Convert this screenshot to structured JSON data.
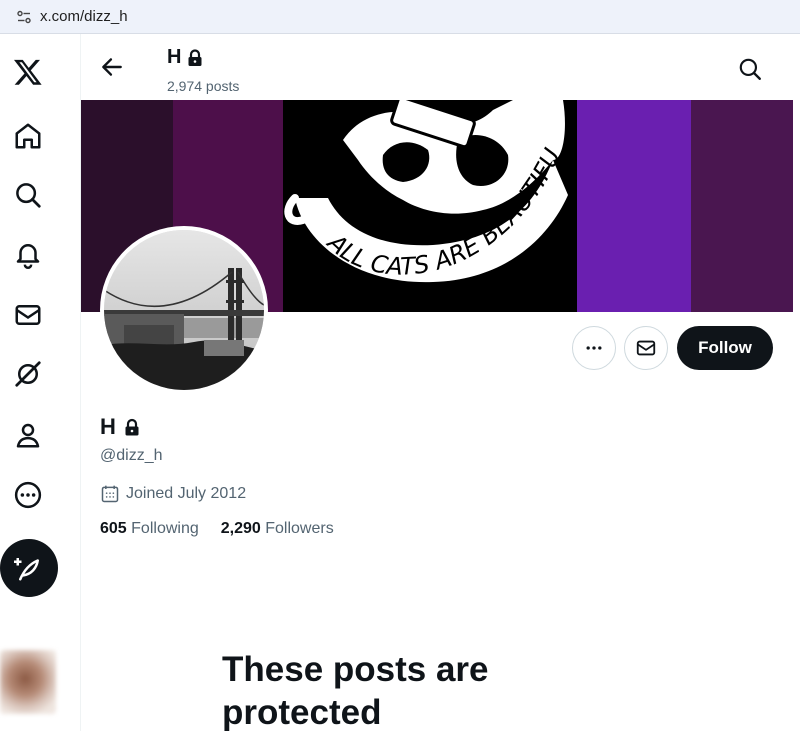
{
  "browser": {
    "url": "x.com/dizz_h"
  },
  "nav": {
    "items": [
      {
        "name": "x-logo-icon"
      },
      {
        "name": "home-icon"
      },
      {
        "name": "explore-icon"
      },
      {
        "name": "notifications-icon"
      },
      {
        "name": "messages-icon"
      },
      {
        "name": "grok-icon"
      },
      {
        "name": "profile-icon"
      },
      {
        "name": "more-icon"
      }
    ],
    "post_button_icon": "post-feather-icon"
  },
  "header": {
    "name": "H",
    "posts_count": "2,974 posts"
  },
  "banner": {
    "colors": [
      "#2b0f2b",
      "#4d0f4a",
      "#000000",
      "#6a1fb0",
      "#4a1650"
    ]
  },
  "profile": {
    "name": "H",
    "handle": "@dizz_h",
    "joined": "Joined July 2012",
    "following_count": "605",
    "following_label": "Following",
    "followers_count": "2,290",
    "followers_label": "Followers",
    "follow_label": "Follow"
  },
  "protected": {
    "title": "These posts are protected"
  }
}
